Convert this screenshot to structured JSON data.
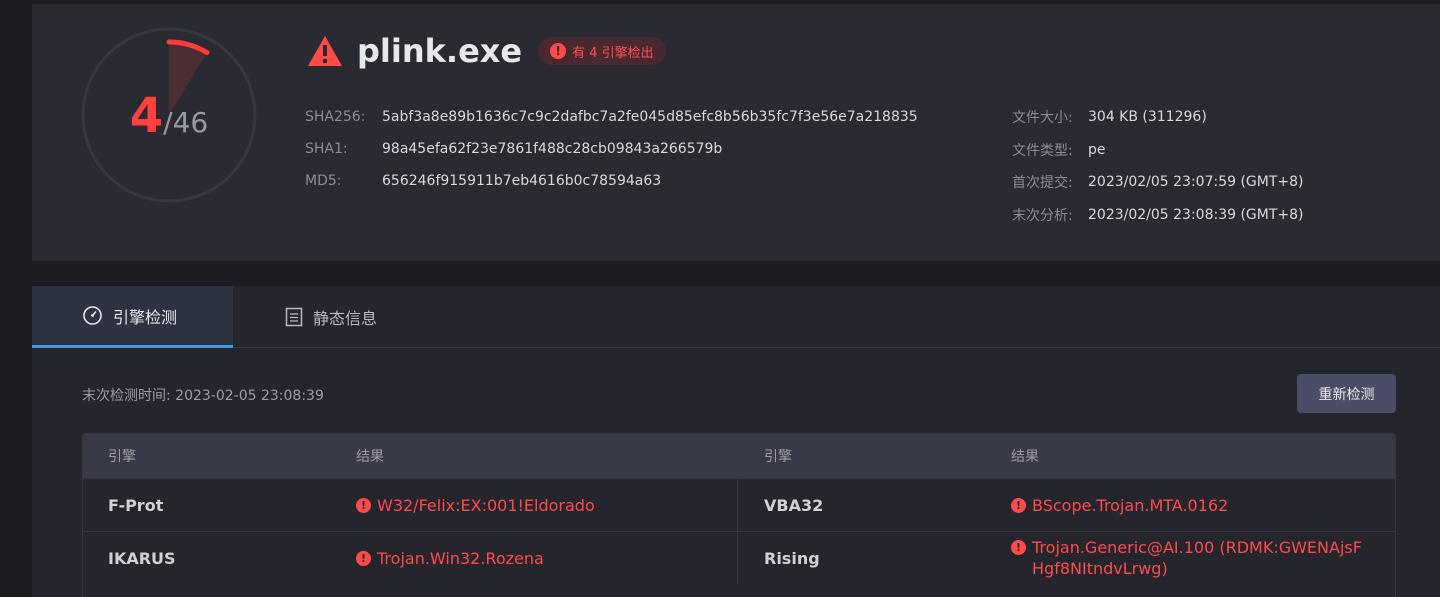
{
  "colors": {
    "accent": "#3a9ad9",
    "danger": "#ff4a4a",
    "card": "#2a2a33",
    "button": "#4b4d66"
  },
  "report": {
    "detected": "4",
    "total": "/46",
    "detection_ratio": 0.087,
    "file_name": "plink.exe",
    "badge": "有 4 引擎检出",
    "hashes": [
      {
        "label": "SHA256:",
        "value": "5abf3a8e89b1636c7c9c2dafbc7a2fe045d85efc8b56b35fc7f3e56e7a218835"
      },
      {
        "label": "SHA1:",
        "value": "98a45efa62f23e7861f488c28cb09843a266579b"
      },
      {
        "label": "MD5:",
        "value": "656246f915911b7eb4616b0c78594a63"
      }
    ],
    "meta": [
      {
        "label": "文件大小:",
        "value": "304 KB (311296)"
      },
      {
        "label": "文件类型:",
        "value": "pe"
      },
      {
        "label": "首次提交:",
        "value": "2023/02/05 23:07:59 (GMT+8)"
      },
      {
        "label": "末次分析:",
        "value": "2023/02/05 23:08:39 (GMT+8)"
      }
    ]
  },
  "tabs": [
    {
      "label": "引擎检测",
      "icon": "gauge-icon",
      "active": true
    },
    {
      "label": "静态信息",
      "icon": "document-icon",
      "active": false
    }
  ],
  "scan": {
    "last_scan": "末次检测时间: 2023-02-05 23:08:39",
    "rescan_label": "重新检测"
  },
  "results": {
    "headers": [
      "引擎",
      "结果",
      "引擎",
      "结果"
    ],
    "rows": [
      {
        "engine1": "F-Prot",
        "result1": "W32/Felix:EX:001!Eldorado",
        "engine2": "VBA32",
        "result2": "BScope.Trojan.MTA.0162"
      },
      {
        "engine1": "IKARUS",
        "result1": "Trojan.Win32.Rozena",
        "engine2": "Rising",
        "result2": "Trojan.Generic@AI.100 (RDMK:GWENAjsFHgf8NItndvLrwg)"
      }
    ]
  }
}
